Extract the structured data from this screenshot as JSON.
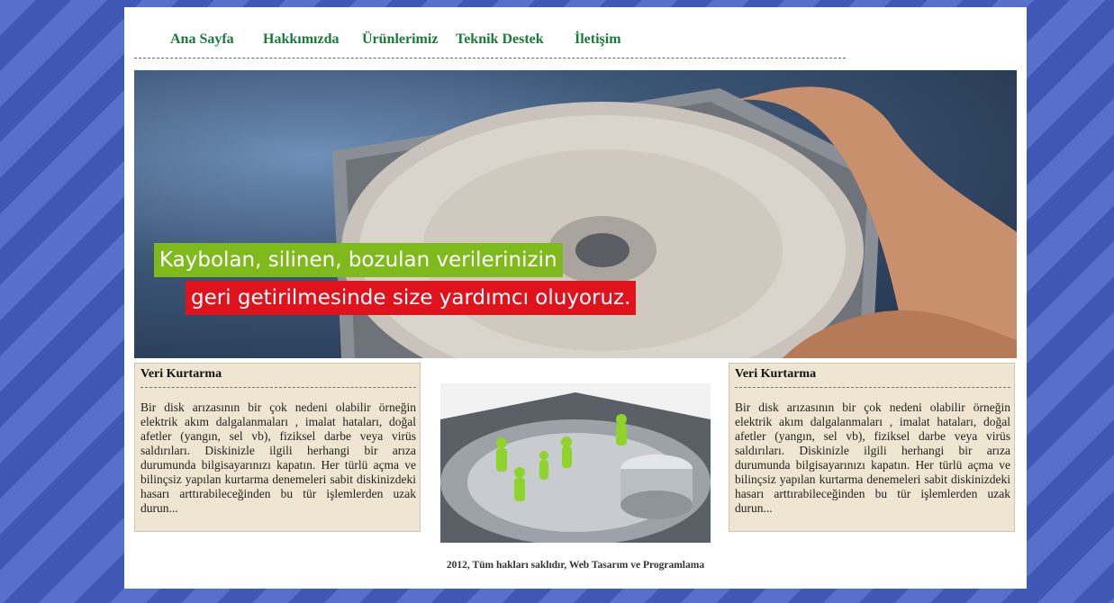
{
  "nav": {
    "items": [
      {
        "label": "Ana Sayfa"
      },
      {
        "label": "Hakkımızda"
      },
      {
        "label": "Ürünlerimiz"
      },
      {
        "label": "Teknik Destek"
      },
      {
        "label": "İletişim"
      }
    ]
  },
  "banner": {
    "line1": "Kaybolan, silinen, bozulan verilerinizin",
    "line2": "geri getirilmesinde size yardımcı oluyoruz.",
    "colors": {
      "line1_bg": "#7fba1c",
      "line2_bg": "#e0121c"
    }
  },
  "left_box": {
    "title": "Veri Kurtarma",
    "text": "Bir disk arızasının bir çok nedeni olabilir örneğin elektrik akım dalgalanmaları , imalat hataları, doğal afetler (yangın, sel vb), fiziksel darbe veya virüs saldırıları. Diskinizle ilgili herhangi bir arıza durumunda bilgisayarınızı kapatın. Her türlü açma ve bilinçsiz yapılan kurtarma denemeleri sabit diskinizdeki hasarı arttırabileceğinden bu tür işlemlerden uzak durun..."
  },
  "right_box": {
    "title": "Veri Kurtarma",
    "text": "Bir disk arızasının bir çok nedeni olabilir örneğin elektrik akım dalgalanmaları , imalat hataları, doğal afetler (yangın, sel vb), fiziksel darbe veya virüs saldırıları. Diskinizle ilgili herhangi bir arıza durumunda bilgisayarınızı kapatın. Her türlü açma ve bilinçsiz yapılan kurtarma denemeleri sabit diskinizdeki hasarı arttırabileceğinden bu tür işlemlerden uzak durun..."
  },
  "footer": {
    "text": "2012, Tüm hakları saklıdır, Web Tasarım ve Programlama"
  },
  "colors": {
    "nav_link": "#1a7a3a",
    "box_bg": "#efe6d1",
    "page_bg": "#4a64c2"
  }
}
